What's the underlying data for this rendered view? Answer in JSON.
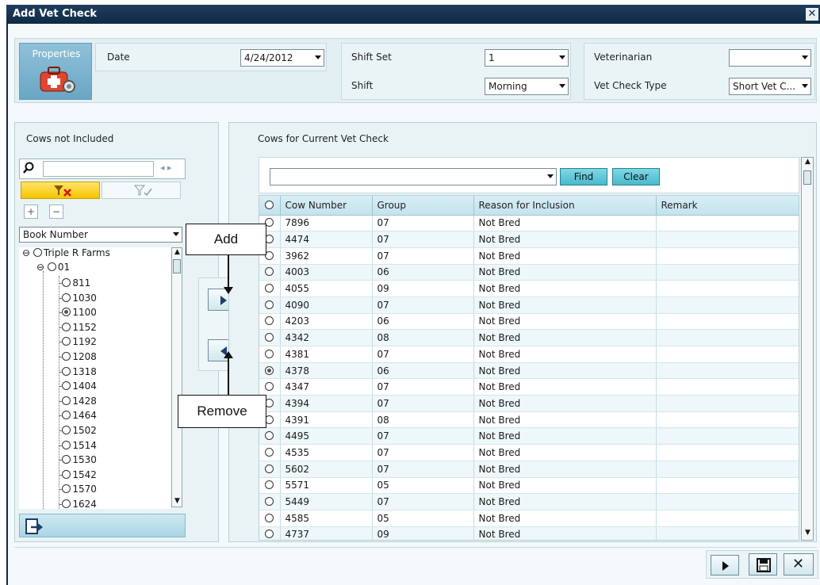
{
  "window": {
    "title": "Add Vet Check"
  },
  "properties": {
    "tile_label": "Properties",
    "date_label": "Date",
    "date_value": "4/24/2012",
    "shift_set_label": "Shift Set",
    "shift_set_value": "1",
    "shift_label": "Shift",
    "shift_value": "Morning",
    "veterinarian_label": "Veterinarian",
    "veterinarian_value": "",
    "vet_check_type_label": "Vet Check Type",
    "vet_check_type_value": "Short Vet C..."
  },
  "left_panel": {
    "title": "Cows not Included",
    "search_value": "",
    "sort_by": "Book Number",
    "tree": {
      "farm": "Triple R Farms",
      "group": "01",
      "cows": [
        {
          "id": "811",
          "checked": false
        },
        {
          "id": "1030",
          "checked": false
        },
        {
          "id": "1100",
          "checked": true
        },
        {
          "id": "1152",
          "checked": false
        },
        {
          "id": "1192",
          "checked": false
        },
        {
          "id": "1208",
          "checked": false
        },
        {
          "id": "1318",
          "checked": false
        },
        {
          "id": "1404",
          "checked": false
        },
        {
          "id": "1428",
          "checked": false
        },
        {
          "id": "1464",
          "checked": false
        },
        {
          "id": "1502",
          "checked": false
        },
        {
          "id": "1514",
          "checked": false
        },
        {
          "id": "1530",
          "checked": false
        },
        {
          "id": "1542",
          "checked": false
        },
        {
          "id": "1570",
          "checked": false
        },
        {
          "id": "1624",
          "checked": false
        }
      ]
    }
  },
  "right_panel": {
    "title": "Cows for Current Vet Check",
    "filter_value": "",
    "find_label": "Find",
    "clear_label": "Clear",
    "columns": [
      "Cow Number",
      "Group",
      "Reason for Inclusion",
      "Remark"
    ],
    "rows": [
      {
        "cow": "7896",
        "group": "07",
        "reason": "Not Bred",
        "remark": "",
        "checked": false
      },
      {
        "cow": "4474",
        "group": "07",
        "reason": "Not Bred",
        "remark": "",
        "checked": false
      },
      {
        "cow": "3962",
        "group": "07",
        "reason": "Not Bred",
        "remark": "",
        "checked": false
      },
      {
        "cow": "4003",
        "group": "06",
        "reason": "Not Bred",
        "remark": "",
        "checked": false
      },
      {
        "cow": "4055",
        "group": "09",
        "reason": "Not Bred",
        "remark": "",
        "checked": false
      },
      {
        "cow": "4090",
        "group": "07",
        "reason": "Not Bred",
        "remark": "",
        "checked": false
      },
      {
        "cow": "4203",
        "group": "06",
        "reason": "Not Bred",
        "remark": "",
        "checked": false
      },
      {
        "cow": "4342",
        "group": "08",
        "reason": "Not Bred",
        "remark": "",
        "checked": false
      },
      {
        "cow": "4381",
        "group": "07",
        "reason": "Not Bred",
        "remark": "",
        "checked": false
      },
      {
        "cow": "4378",
        "group": "06",
        "reason": "Not Bred",
        "remark": "",
        "checked": true
      },
      {
        "cow": "4347",
        "group": "07",
        "reason": "Not Bred",
        "remark": "",
        "checked": false
      },
      {
        "cow": "4394",
        "group": "07",
        "reason": "Not Bred",
        "remark": "",
        "checked": false
      },
      {
        "cow": "4391",
        "group": "08",
        "reason": "Not Bred",
        "remark": "",
        "checked": false
      },
      {
        "cow": "4495",
        "group": "07",
        "reason": "Not Bred",
        "remark": "",
        "checked": false
      },
      {
        "cow": "4535",
        "group": "07",
        "reason": "Not Bred",
        "remark": "",
        "checked": false
      },
      {
        "cow": "5602",
        "group": "07",
        "reason": "Not Bred",
        "remark": "",
        "checked": false
      },
      {
        "cow": "5571",
        "group": "05",
        "reason": "Not Bred",
        "remark": "",
        "checked": false
      },
      {
        "cow": "5449",
        "group": "07",
        "reason": "Not Bred",
        "remark": "",
        "checked": false
      },
      {
        "cow": "4585",
        "group": "05",
        "reason": "Not Bred",
        "remark": "",
        "checked": false
      },
      {
        "cow": "4737",
        "group": "09",
        "reason": "Not Bred",
        "remark": "",
        "checked": false
      }
    ]
  },
  "callouts": {
    "add": "Add",
    "remove": "Remove"
  },
  "colors": {
    "titlebar": "#0f2a45",
    "accent_button": "#49b9cc",
    "header": "#c3e3ee"
  }
}
